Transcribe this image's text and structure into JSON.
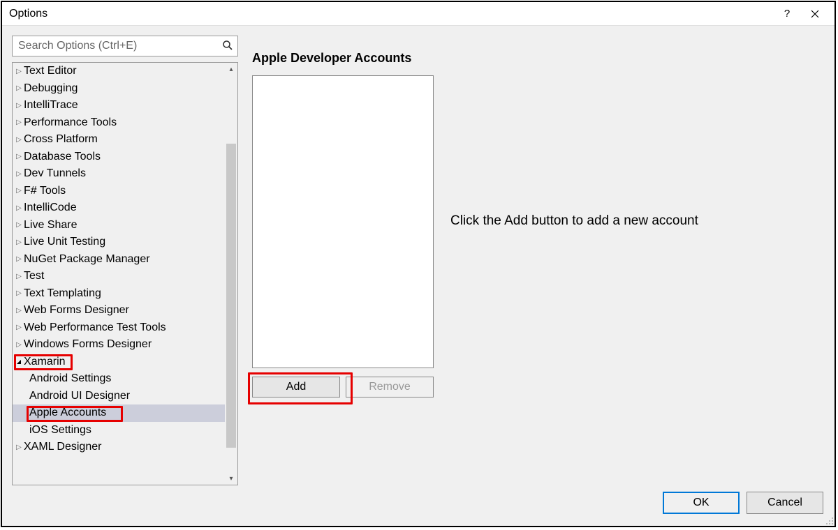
{
  "window": {
    "title": "Options"
  },
  "search": {
    "placeholder": "Search Options (Ctrl+E)"
  },
  "tree": [
    {
      "label": "Text Editor",
      "level": 0,
      "expanded": false
    },
    {
      "label": "Debugging",
      "level": 0,
      "expanded": false
    },
    {
      "label": "IntelliTrace",
      "level": 0,
      "expanded": false
    },
    {
      "label": "Performance Tools",
      "level": 0,
      "expanded": false
    },
    {
      "label": "Cross Platform",
      "level": 0,
      "expanded": false
    },
    {
      "label": "Database Tools",
      "level": 0,
      "expanded": false
    },
    {
      "label": "Dev Tunnels",
      "level": 0,
      "expanded": false
    },
    {
      "label": "F# Tools",
      "level": 0,
      "expanded": false
    },
    {
      "label": "IntelliCode",
      "level": 0,
      "expanded": false
    },
    {
      "label": "Live Share",
      "level": 0,
      "expanded": false
    },
    {
      "label": "Live Unit Testing",
      "level": 0,
      "expanded": false
    },
    {
      "label": "NuGet Package Manager",
      "level": 0,
      "expanded": false
    },
    {
      "label": "Test",
      "level": 0,
      "expanded": false
    },
    {
      "label": "Text Templating",
      "level": 0,
      "expanded": false
    },
    {
      "label": "Web Forms Designer",
      "level": 0,
      "expanded": false
    },
    {
      "label": "Web Performance Test Tools",
      "level": 0,
      "expanded": false
    },
    {
      "label": "Windows Forms Designer",
      "level": 0,
      "expanded": false
    },
    {
      "label": "Xamarin",
      "level": 0,
      "expanded": true,
      "highlight": true
    },
    {
      "label": "Android Settings",
      "level": 1
    },
    {
      "label": "Android UI Designer",
      "level": 1
    },
    {
      "label": "Apple Accounts",
      "level": 1,
      "selected": true,
      "highlight": true
    },
    {
      "label": "iOS Settings",
      "level": 1
    },
    {
      "label": "XAML Designer",
      "level": 0,
      "expanded": false
    }
  ],
  "panel": {
    "title": "Apple Developer Accounts",
    "hint": "Click the Add button to add a new account",
    "add_label": "Add",
    "remove_label": "Remove"
  },
  "footer": {
    "ok_label": "OK",
    "cancel_label": "Cancel"
  }
}
